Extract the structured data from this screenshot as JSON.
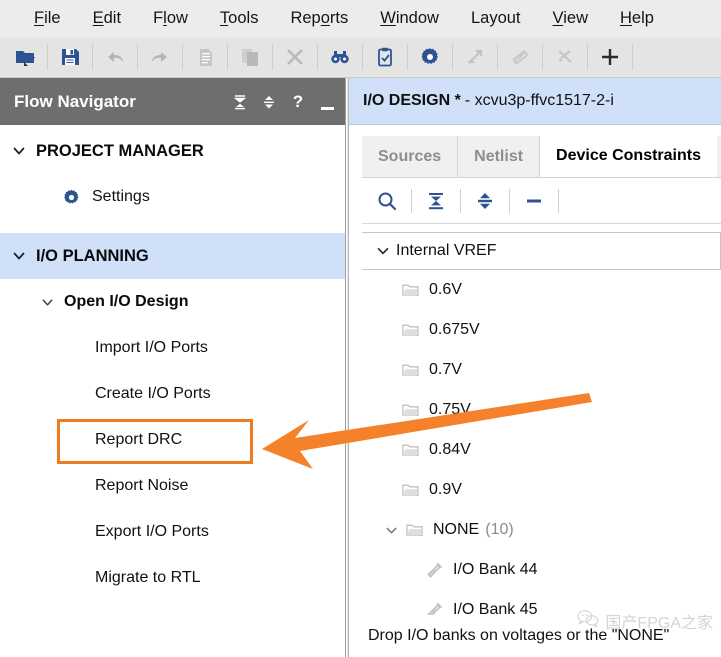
{
  "menubar": {
    "items": [
      {
        "label": "File",
        "mnemonic_index": 0
      },
      {
        "label": "Edit",
        "mnemonic_index": 0
      },
      {
        "label": "Flow",
        "mnemonic_index": 1
      },
      {
        "label": "Tools",
        "mnemonic_index": 0
      },
      {
        "label": "Reports",
        "mnemonic_index": 4
      },
      {
        "label": "Window",
        "mnemonic_index": 0
      },
      {
        "label": "Layout",
        "mnemonic_index": -1
      },
      {
        "label": "View",
        "mnemonic_index": 0
      },
      {
        "label": "Help",
        "mnemonic_index": 0
      }
    ]
  },
  "toolbar": {
    "buttons": [
      {
        "name": "open-project-icon",
        "enabled": true
      },
      {
        "name": "save-icon",
        "enabled": true
      },
      {
        "name": "undo-icon",
        "enabled": false
      },
      {
        "name": "redo-icon",
        "enabled": false
      },
      {
        "name": "copy-icon",
        "enabled": false
      },
      {
        "name": "paste-icon",
        "enabled": false
      },
      {
        "name": "close-icon",
        "enabled": false
      },
      {
        "name": "binoculars-icon",
        "enabled": true
      },
      {
        "name": "clipboard-check-icon",
        "enabled": true
      },
      {
        "name": "gear-icon",
        "enabled": true
      },
      {
        "name": "run-synthesis-icon",
        "enabled": false
      },
      {
        "name": "run-implementation-icon",
        "enabled": false
      },
      {
        "name": "generate-bitstream-icon",
        "enabled": false
      },
      {
        "name": "add-icon",
        "enabled": true
      }
    ]
  },
  "flow_navigator": {
    "title": "Flow Navigator",
    "header_actions": [
      {
        "name": "collapse-all-icon",
        "label": ""
      },
      {
        "name": "expand-collapse-icon",
        "label": ""
      },
      {
        "name": "help-icon",
        "label": "?"
      },
      {
        "name": "minimize-icon",
        "label": ""
      }
    ],
    "sections": [
      {
        "label": "PROJECT MANAGER",
        "expanded": true,
        "active": false,
        "children": [
          {
            "label": "Settings",
            "icon": "gear-icon",
            "kind": "item"
          }
        ]
      },
      {
        "label": "I/O PLANNING",
        "expanded": true,
        "active": true,
        "children": [
          {
            "label": "Open I/O Design",
            "kind": "sub",
            "expanded": true
          },
          {
            "label": "Import I/O Ports",
            "kind": "leaf"
          },
          {
            "label": "Create I/O Ports",
            "kind": "leaf"
          },
          {
            "label": "Report DRC",
            "kind": "leaf",
            "highlighted": true
          },
          {
            "label": "Report Noise",
            "kind": "leaf"
          },
          {
            "label": "Export I/O Ports",
            "kind": "leaf"
          },
          {
            "label": "Migrate to RTL",
            "kind": "leaf"
          }
        ]
      }
    ]
  },
  "right_pane": {
    "title_bold": "I/O DESIGN *",
    "title_rest": "- xcvu3p-ffvc1517-2-i",
    "tabs": [
      {
        "label": "Sources",
        "active": false
      },
      {
        "label": "Netlist",
        "active": false
      },
      {
        "label": "Device Constraints",
        "active": true
      }
    ],
    "tree_toolbar": [
      {
        "name": "search-icon"
      },
      {
        "name": "collapse-all-icon"
      },
      {
        "name": "expand-all-icon"
      },
      {
        "name": "collapse-icon"
      }
    ],
    "tree": {
      "root_label": "Internal VREF",
      "root_expanded": true,
      "voltages": [
        {
          "label": "0.6V",
          "icon": "folder-icon"
        },
        {
          "label": "0.675V",
          "icon": "folder-icon"
        },
        {
          "label": "0.7V",
          "icon": "folder-icon"
        },
        {
          "label": "0.75V",
          "icon": "folder-icon"
        },
        {
          "label": "0.84V",
          "icon": "folder-icon"
        },
        {
          "label": "0.9V",
          "icon": "folder-icon"
        }
      ],
      "none_group": {
        "label": "NONE",
        "count": "(10)",
        "expanded": true,
        "icon": "folder-icon",
        "children": [
          {
            "label": "I/O Bank 44",
            "icon": "io-bank-icon"
          },
          {
            "label": "I/O Bank 45",
            "icon": "io-bank-icon"
          }
        ]
      }
    },
    "footer_hint": "Drop I/O banks on voltages or the \"NONE\""
  },
  "annotation": {
    "arrow_color": "#f5822a",
    "box_color": "#f07c20",
    "target_label": "Report DRC"
  },
  "watermark": {
    "text": "国产FPGA之家",
    "icon": "wechat-icon"
  },
  "colors": {
    "accent_blue": "#2e5392",
    "panel_header_gray": "#6e6e6e",
    "highlight_blue": "#cfe0f8",
    "orange": "#f5822a"
  }
}
